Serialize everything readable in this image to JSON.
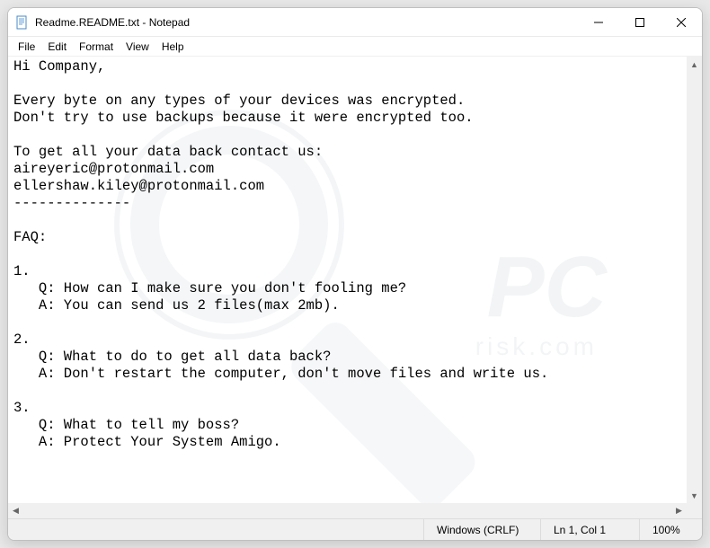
{
  "window": {
    "title": "Readme.README.txt - Notepad"
  },
  "menu": {
    "file": "File",
    "edit": "Edit",
    "format": "Format",
    "view": "View",
    "help": "Help"
  },
  "content": "Hi Company,\n\nEvery byte on any types of your devices was encrypted.\nDon't try to use backups because it were encrypted too.\n\nTo get all your data back contact us:\naireyeric@protonmail.com\nellershaw.kiley@protonmail.com\n--------------\n\nFAQ:\n\n1.\n   Q: How can I make sure you don't fooling me?\n   A: You can send us 2 files(max 2mb).\n\n2.\n   Q: What to do to get all data back?\n   A: Don't restart the computer, don't move files and write us.\n\n3.\n   Q: What to tell my boss?\n   A: Protect Your System Amigo.",
  "status": {
    "lineending": "Windows (CRLF)",
    "position": "Ln 1, Col 1",
    "zoom": "100%"
  },
  "watermark": {
    "brand": "PC",
    "sub": "risk.com"
  }
}
